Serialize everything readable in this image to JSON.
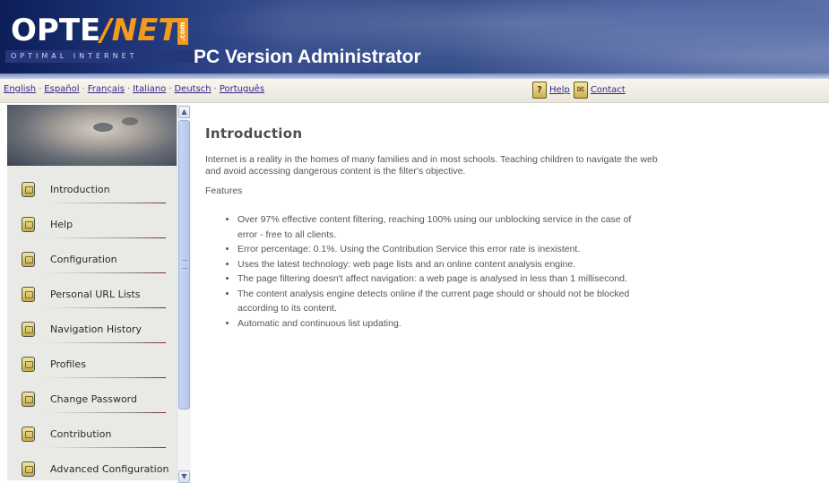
{
  "header": {
    "logo_opte": "OPTE",
    "logo_net": "NET",
    "logo_com": ".com",
    "logo_tagline": "OPTIMAL INTERNET",
    "app_title": "PC Version Administrator"
  },
  "languages": [
    "English",
    "Español",
    "Français",
    "Italiano",
    "Deutsch",
    "Português"
  ],
  "help_links": {
    "help_icon": "question-mark-icon",
    "help_label": "Help",
    "contact_icon": "contact-icon",
    "contact_label": "Contact"
  },
  "sidebar": {
    "items": [
      {
        "label": "Introduction"
      },
      {
        "label": "Help"
      },
      {
        "label": "Configuration"
      },
      {
        "label": "Personal URL Lists"
      },
      {
        "label": "Navigation History"
      },
      {
        "label": "Profiles"
      },
      {
        "label": "Change Password"
      },
      {
        "label": "Contribution"
      },
      {
        "label": "Advanced Configuration"
      }
    ]
  },
  "main": {
    "title": "Introduction",
    "intro": "Internet is a reality in the homes of many families and in most schools. Teaching children to navigate the web and avoid accessing dangerous content is the filter's objective.",
    "features_heading": "Features",
    "features": [
      "Over 97% effective content filtering, reaching 100% using our unblocking service in the case of error - free to all clients.",
      "Error percentage: 0.1%. Using the Contribution Service this error rate is inexistent.",
      "Uses the latest technology: web page lists and an online content analysis engine.",
      "The page filtering doesn't affect navigation: a web page is analysed in less than 1 millisecond.",
      "The content analysis engine detects online if the current page should or should not be blocked according to its content.",
      "Automatic and continuous list updating."
    ]
  },
  "colors": {
    "header_blue": "#2a3f82",
    "logo_orange": "#f29b1d",
    "link_purple": "#3a1f8a",
    "sidebar_bg": "#e9e9e6"
  }
}
